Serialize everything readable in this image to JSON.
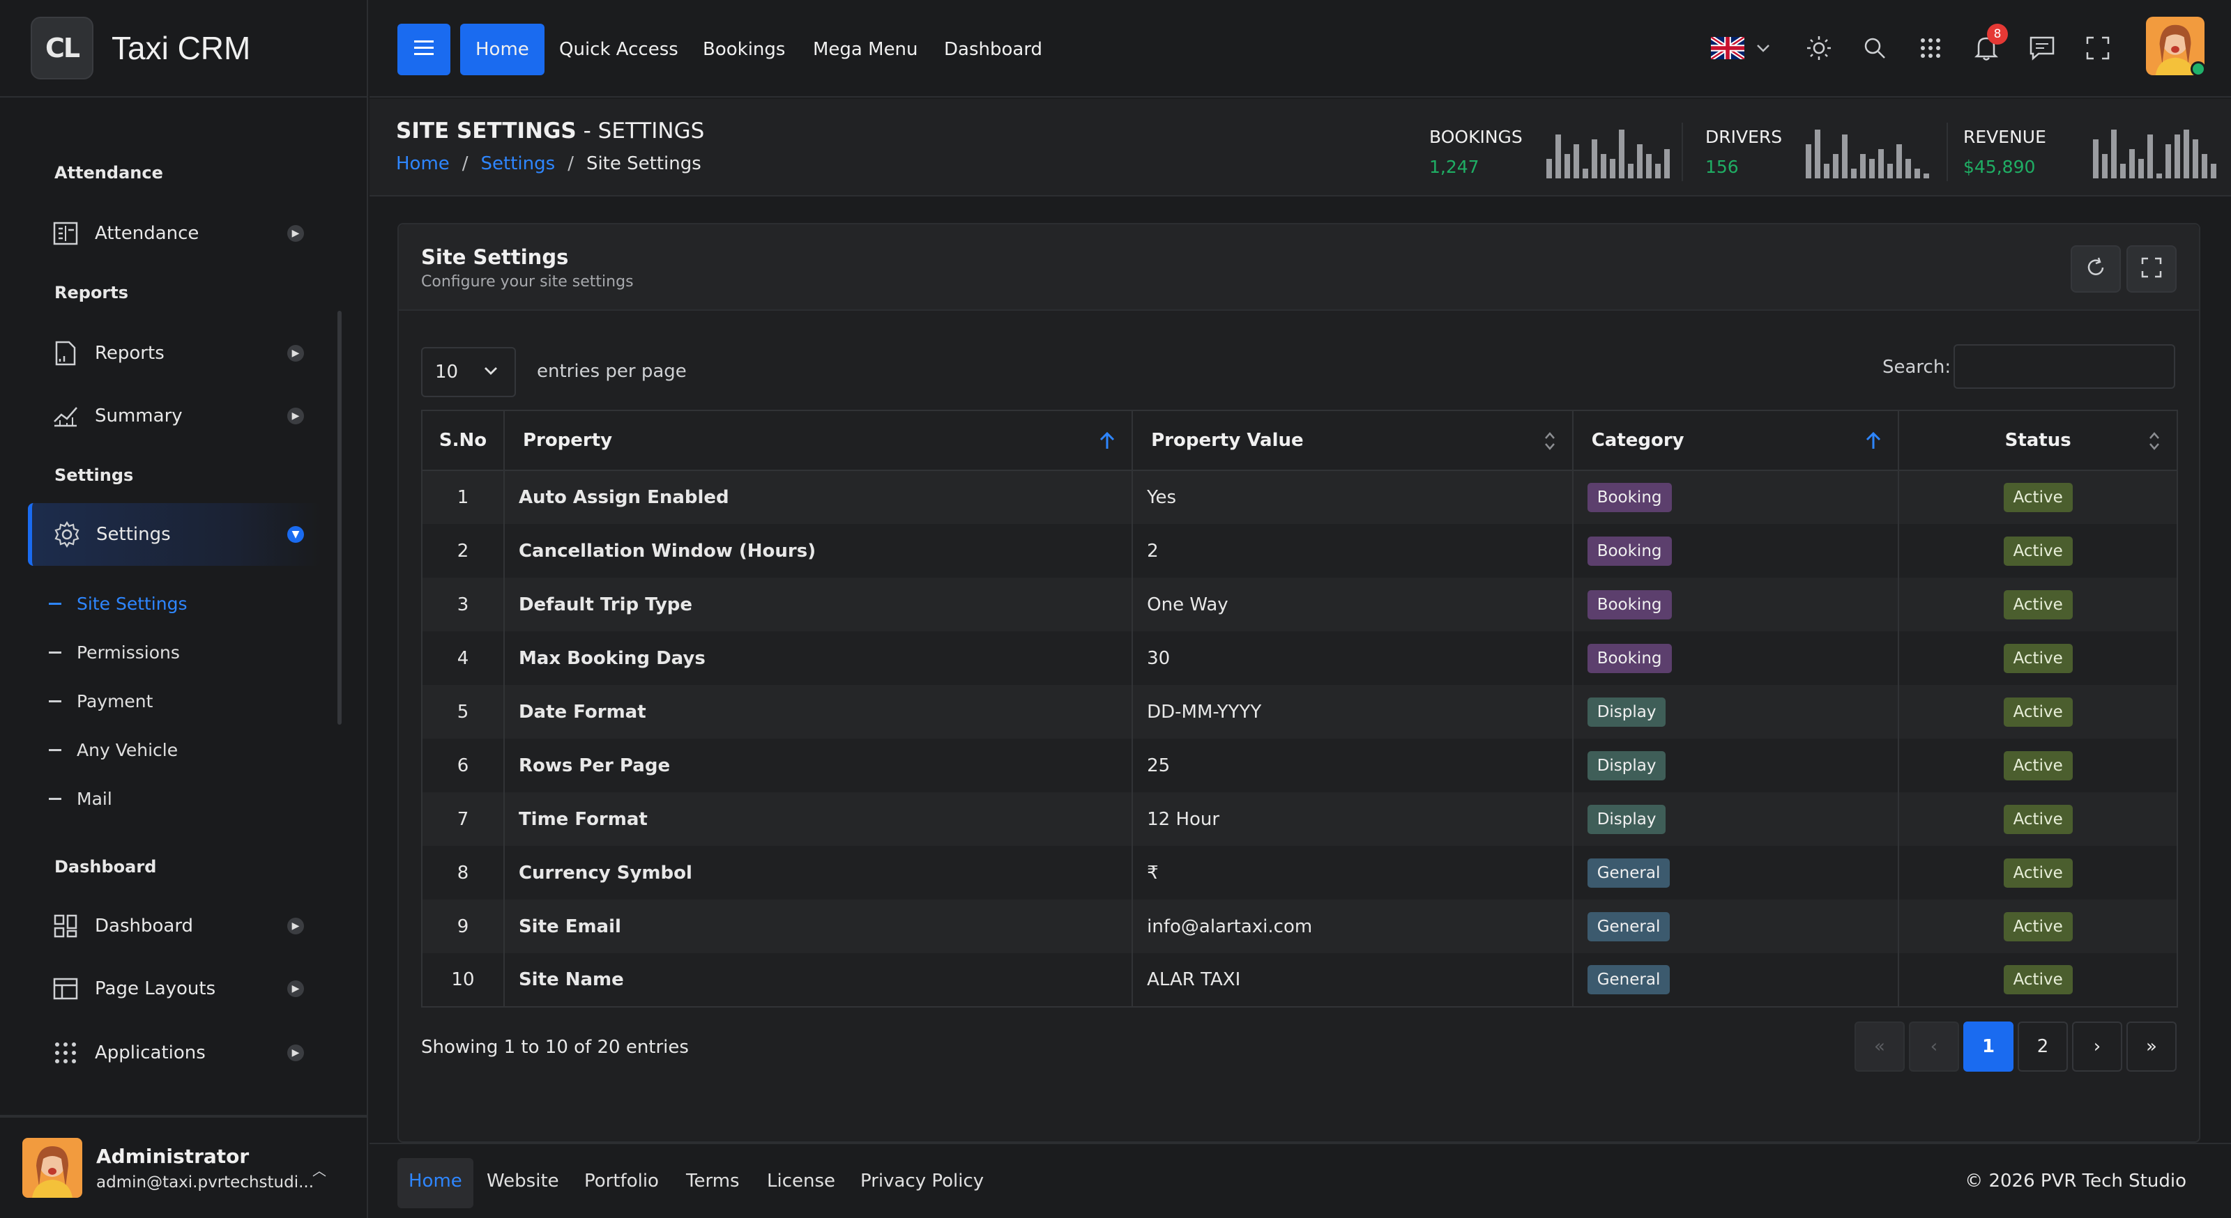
{
  "brand": {
    "logo_text": "CL",
    "name": "Taxi CRM"
  },
  "sidebar": {
    "sections": [
      {
        "title": "Attendance"
      },
      {
        "title": "Reports"
      },
      {
        "title": "Settings"
      },
      {
        "title": "Dashboard"
      }
    ],
    "items": [
      {
        "label": "Attendance",
        "icon": "attendance-icon"
      },
      {
        "label": "Reports",
        "icon": "report-icon"
      },
      {
        "label": "Summary",
        "icon": "chart-line-icon"
      },
      {
        "label": "Settings",
        "icon": "gear-icon"
      },
      {
        "label": "Dashboard",
        "icon": "dashboard-grid-icon"
      },
      {
        "label": "Page Layouts",
        "icon": "layout-icon"
      },
      {
        "label": "Applications",
        "icon": "apps-grid-icon"
      }
    ],
    "submenu": [
      "Site Settings",
      "Permissions",
      "Payment",
      "Any Vehicle",
      "Mail"
    ],
    "user": {
      "name": "Administrator",
      "email": "admin@taxi.pvrtechstudi..."
    }
  },
  "topbar": {
    "nav": [
      "Home",
      "Quick Access",
      "Bookings",
      "Mega Menu",
      "Dashboard"
    ],
    "notification_count": "8",
    "language": "uk-flag"
  },
  "page_header": {
    "title_bold": "SITE SETTINGS",
    "title_sep": " - ",
    "title_rest": "SETTINGS",
    "breadcrumb": [
      "Home",
      "Settings",
      "Site Settings"
    ],
    "stats": [
      {
        "label": "BOOKINGS",
        "value": "1,247",
        "bars": [
          8,
          18,
          10,
          14,
          4,
          16,
          10,
          8,
          20,
          6,
          14,
          10,
          6,
          12
        ]
      },
      {
        "label": "DRIVERS",
        "value": "156",
        "bars": [
          14,
          20,
          6,
          10,
          18,
          4,
          10,
          8,
          12,
          6,
          14,
          8,
          4,
          2
        ]
      },
      {
        "label": "REVENUE",
        "value": "$45,890",
        "bars": [
          16,
          10,
          20,
          6,
          12,
          8,
          18,
          2,
          14,
          18,
          20,
          16,
          10,
          6
        ]
      }
    ],
    "accent_value_color": "#1fae64"
  },
  "card": {
    "title": "Site Settings",
    "subtitle": "Configure your site settings",
    "page_length": "10",
    "entries_label": "entries per page",
    "search_label": "Search:",
    "search_value": "",
    "columns": [
      "S.No",
      "Property",
      "Property Value",
      "Category",
      "Status"
    ],
    "rows": [
      {
        "sno": "1",
        "property": "Auto Assign Enabled",
        "value": "Yes",
        "category": "Booking",
        "status": "Active"
      },
      {
        "sno": "2",
        "property": "Cancellation Window (Hours)",
        "value": "2",
        "category": "Booking",
        "status": "Active"
      },
      {
        "sno": "3",
        "property": "Default Trip Type",
        "value": "One Way",
        "category": "Booking",
        "status": "Active"
      },
      {
        "sno": "4",
        "property": "Max Booking Days",
        "value": "30",
        "category": "Booking",
        "status": "Active"
      },
      {
        "sno": "5",
        "property": "Date Format",
        "value": "DD-MM-YYYY",
        "category": "Display",
        "status": "Active"
      },
      {
        "sno": "6",
        "property": "Rows Per Page",
        "value": "25",
        "category": "Display",
        "status": "Active"
      },
      {
        "sno": "7",
        "property": "Time Format",
        "value": "12 Hour",
        "category": "Display",
        "status": "Active"
      },
      {
        "sno": "8",
        "property": "Currency Symbol",
        "value": "₹",
        "category": "General",
        "status": "Active"
      },
      {
        "sno": "9",
        "property": "Site Email",
        "value": "info@alartaxi.com",
        "category": "General",
        "status": "Active"
      },
      {
        "sno": "10",
        "property": "Site Name",
        "value": "ALAR TAXI",
        "category": "General",
        "status": "Active"
      }
    ],
    "showing": "Showing 1 to 10 of 20 entries",
    "pagination": {
      "pages": [
        "1",
        "2"
      ],
      "current": "1"
    }
  },
  "footer": {
    "links": [
      "Home",
      "Website",
      "Portfolio",
      "Terms",
      "License",
      "Privacy Policy"
    ],
    "copyright": "© 2026  PVR Tech Studio"
  }
}
